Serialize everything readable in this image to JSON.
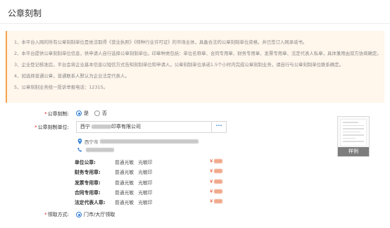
{
  "page": {
    "title": "公章刻制"
  },
  "notice": {
    "lines": [
      "1、本平台入网的所有公章刻制单位是依法取得《营业执照》《特种行业许可证》的市场主体，具备合法的公章刻制单位资格，并已签订入网承诺书。",
      "2、本平台提供公章刻制单位信息，供申请人自行选择公章刻制单位。印章种类包括：单位名称章、合同专用章、财务专用章、发票专用章、法定代表人私章，具体兼用由双方协商确定。",
      "3、企业登记核准后，平台会将企业基本信息以短信方式告知刻制单位和申请人。公章刻制单位承诺1.5个小时内完成公章刻制业务，请自行与公章刻制单位联系确定。",
      "4、如选择普通公章，普通联系人默认为企业法定代表人。",
      "5、公章刻制业务统一投诉举报电话：12315。"
    ]
  },
  "form": {
    "seal_label": "公章刻制:",
    "seal_options": [
      "是",
      "否"
    ],
    "seal_selected": "是",
    "unit_label": "公章刻制单位:",
    "unit_value": "西宁",
    "unit_value_suffix": "印章有限公司",
    "unit_more": "···",
    "address_prefix": "西宁市",
    "seals": [
      {
        "name": "单位公章:",
        "opt1": "普通光敏",
        "opt2": "光敏印",
        "currency": "¥"
      },
      {
        "name": "财务专用章:",
        "opt1": "普通光敏",
        "opt2": "光敏印",
        "currency": "¥"
      },
      {
        "name": "发票专用章:",
        "opt1": "普通光敏",
        "opt2": "光敏印",
        "currency": "¥"
      },
      {
        "name": "合同专用章:",
        "opt1": "普通光敏",
        "opt2": "光敏印",
        "currency": "¥"
      },
      {
        "name": "法定代表人章:",
        "opt1": "普通光敏",
        "opt2": "光敏印",
        "currency": "¥"
      }
    ],
    "pickup_label": "领取方式:",
    "pickup_option": "门市/大厅领取"
  },
  "sample": {
    "label": "样例"
  },
  "colors": {
    "accent": "#2d7cd6",
    "warning_bg": "#fff6ec",
    "price": "#e4572e",
    "required": "#e02020"
  }
}
